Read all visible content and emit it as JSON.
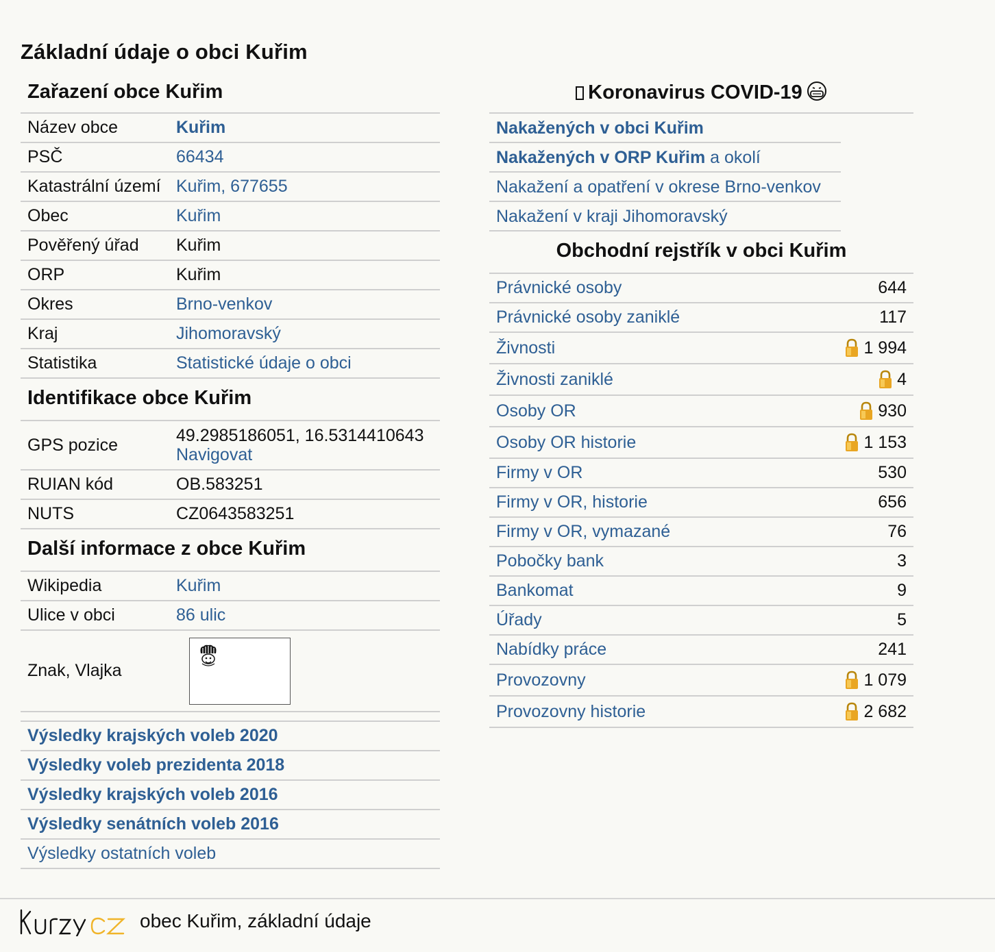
{
  "page_title": "Základní údaje o obci Kuřim",
  "zarazeni": {
    "heading": "Zařazení obce Kuřim",
    "rows": [
      {
        "label": "Název obce",
        "value": "Kuřim",
        "link": true,
        "bold": true
      },
      {
        "label": "PSČ",
        "value": "66434",
        "link": true,
        "bold": false
      },
      {
        "label": "Katastrální území",
        "value": "Kuřim, 677655",
        "link": true,
        "bold": false
      },
      {
        "label": "Obec",
        "value": "Kuřim",
        "link": true,
        "bold": false
      },
      {
        "label": "Pověřený úřad",
        "value": "Kuřim",
        "link": false,
        "bold": false
      },
      {
        "label": "ORP",
        "value": "Kuřim",
        "link": false,
        "bold": false
      },
      {
        "label": "Okres",
        "value": "Brno-venkov",
        "link": true,
        "bold": false
      },
      {
        "label": "Kraj",
        "value": "Jihomoravský",
        "link": true,
        "bold": false
      },
      {
        "label": "Statistika",
        "value": "Statistické údaje o obci",
        "link": true,
        "bold": false
      }
    ]
  },
  "identifikace": {
    "heading": "Identifikace obce Kuřim",
    "gps_label": "GPS pozice",
    "gps_value": "49.2985186051, 16.5314410643",
    "gps_nav": "Navigovat",
    "ruian_label": "RUIAN kód",
    "ruian_value": "OB.583251",
    "nuts_label": "NUTS",
    "nuts_value": "CZ0643583251"
  },
  "dalsi": {
    "heading": "Další informace z obce Kuřim",
    "wiki_label": "Wikipedia",
    "wiki_value": "Kuřim",
    "ulice_label": "Ulice v obci",
    "ulice_value": "86 ulic",
    "znak_label": "Znak, Vlajka"
  },
  "volby": [
    {
      "label": "Výsledky krajských voleb 2020",
      "bold": true
    },
    {
      "label": "Výsledky voleb prezidenta 2018",
      "bold": true
    },
    {
      "label": "Výsledky krajských voleb 2016",
      "bold": true
    },
    {
      "label": "Výsledky senátních voleb 2016",
      "bold": true
    },
    {
      "label": "Výsledky ostatních voleb",
      "bold": false
    }
  ],
  "covid": {
    "heading": "Koronavirus COVID-19",
    "icons": {
      "heading_left": "box-glyph",
      "heading_right": "mask-face-icon"
    },
    "links": [
      {
        "bold_part": "Nakažených v obci Kuřim",
        "plain_part": ""
      },
      {
        "bold_part": "Nakažených v ORP Kuřim",
        "plain_part": " a okolí"
      },
      {
        "bold_part": "",
        "plain_part": "Nakažení a opatření v okrese Brno-venkov"
      },
      {
        "bold_part": "",
        "plain_part": "Nakažení v kraji Jihomoravský"
      }
    ]
  },
  "obchodni": {
    "heading": "Obchodní rejstřík v obci Kuřim",
    "rows": [
      {
        "label": "Právnické osoby",
        "value": "644",
        "locked": false
      },
      {
        "label": "Právnické osoby zaniklé",
        "value": "117",
        "locked": false
      },
      {
        "label": "Živnosti",
        "value": "1 994",
        "locked": true
      },
      {
        "label": "Živnosti zaniklé",
        "value": "4",
        "locked": true
      },
      {
        "label": "Osoby OR",
        "value": "930",
        "locked": true
      },
      {
        "label": "Osoby OR historie",
        "value": "1 153",
        "locked": true
      },
      {
        "label": "Firmy v OR",
        "value": "530",
        "locked": false
      },
      {
        "label": "Firmy v OR, historie",
        "value": "656",
        "locked": false
      },
      {
        "label": "Firmy v OR, vymazané",
        "value": "76",
        "locked": false
      },
      {
        "label": "Pobočky bank",
        "value": "3",
        "locked": false
      },
      {
        "label": "Bankomat",
        "value": "9",
        "locked": false
      },
      {
        "label": "Úřady",
        "value": "5",
        "locked": false
      },
      {
        "label": "Nabídky práce",
        "value": "241",
        "locked": false
      },
      {
        "label": "Provozovny",
        "value": "1 079",
        "locked": true
      },
      {
        "label": "Provozovny historie",
        "value": "2 682",
        "locked": true
      }
    ]
  },
  "footer": {
    "logo_left": "KURZY",
    "logo_right": "CZ",
    "text": "obec Kuřim, základní údaje"
  },
  "colors": {
    "link": "#2e5f94",
    "logo_accent": "#f0b429",
    "lock": "#e9a623"
  }
}
